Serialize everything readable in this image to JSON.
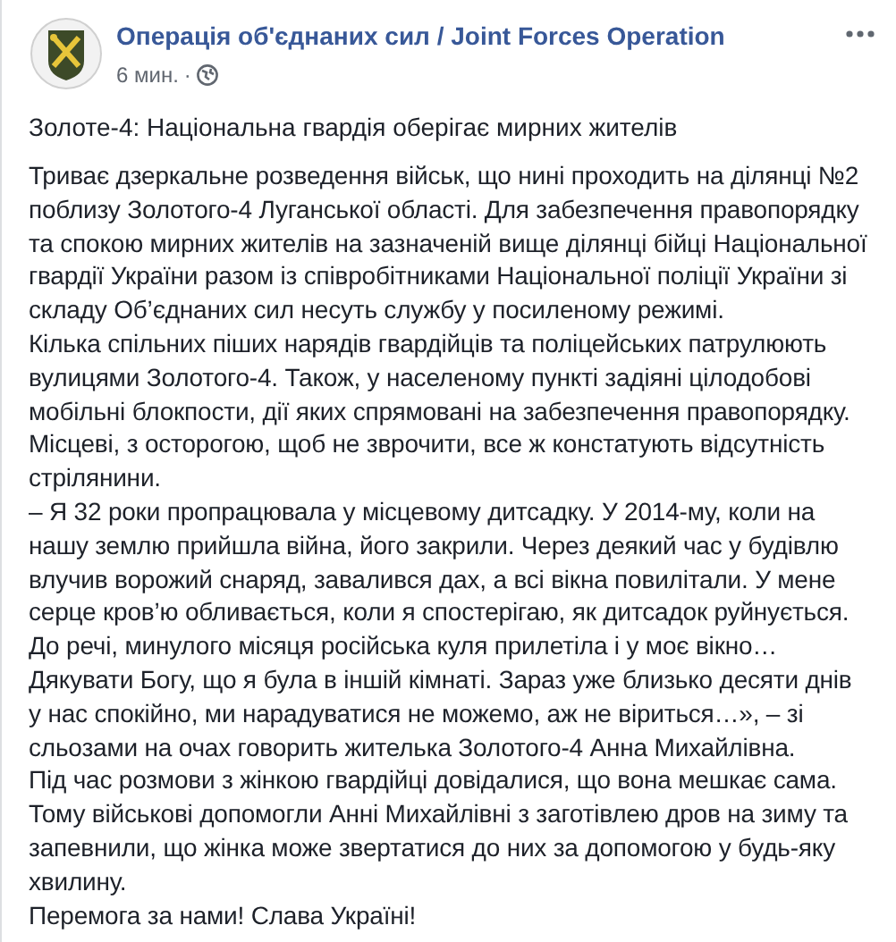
{
  "post": {
    "author": "Операція об'єднаних сил / Joint Forces Operation",
    "time": "6 мин.",
    "separator": "·",
    "title": "Золоте-4: Національна гвардія оберігає мирних жителів",
    "paragraphs": [
      "Триває дзеркальне розведення військ, що нині проходить на ділянці №2 поблизу Золотого-4 Луганської області. Для забезпечення правопорядку та спокою мирних жителів на зазначеній вище ділянці бійці Національної гвардії України разом із співробітниками Національної поліції України зі складу Об’єднаних сил несуть службу у посиленому режимі.",
      "Кілька спільних піших нарядів гвардійців та поліцейських патрулюють вулицями Золотого-4. Також, у населеному пункті задіяні цілодобові мобільні блокпости, дії яких спрямовані на забезпечення правопорядку. Місцеві, з осторогою, щоб не зврочити, все ж констатують відсутність стрілянини.",
      "– Я 32 роки пропрацювала у місцевому дитсадку. У 2014-му, коли на нашу землю прийшла війна, його закрили. Через деякий час у будівлю влучив ворожий снаряд, завалився дах, а всі вікна повилітали. У мене серце кров’ю обливається, коли я спостерігаю, як дитсадок руйнується. До речі, минулого місяця російська куля прилетіла і у моє вікно… Дякувати Богу, що я була в іншій кімнаті. Зараз уже близько десяти днів у нас спокійно, ми нарадуватися не можемо, аж не віриться…», – зі сльозами на очах говорить жителька Золотого-4 Анна Михайлівна.",
      "Під час розмови з жінкою гвардійці довідалися, що вона мешкає сама.",
      "Тому військові допомогли Анні Михайлівні з заготівлею дров на зиму та запевнили, що жінка може звертатися до них за допомогою у будь-яку хвилину.",
      "Перемога за нами! Слава Україні!"
    ]
  }
}
